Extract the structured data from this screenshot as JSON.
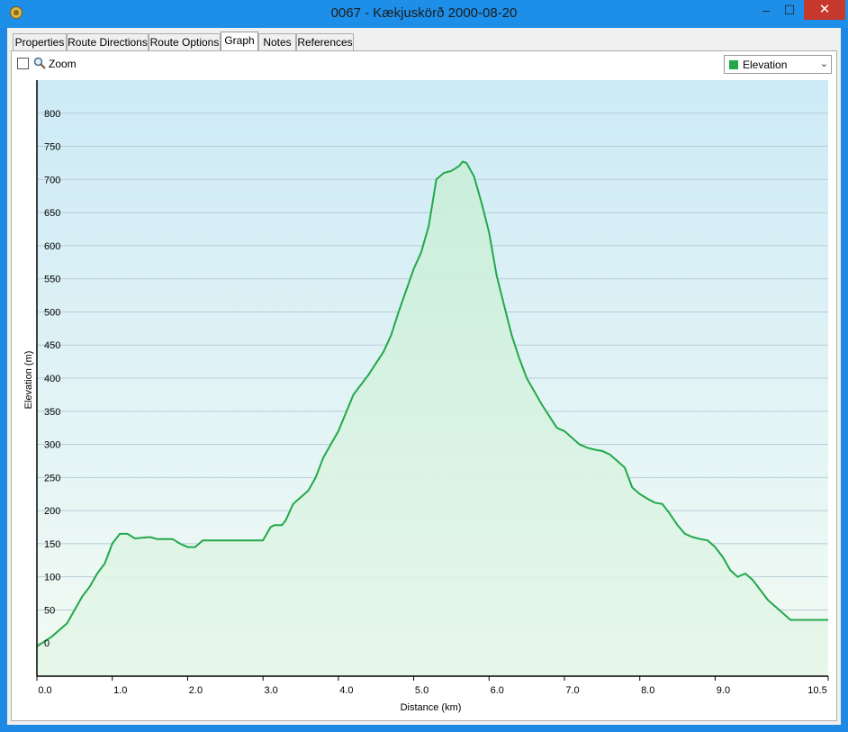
{
  "window": {
    "title": "0067 - Kækjuskörð 2000-08-20",
    "minimize_label": "–",
    "maximize_label": "☐",
    "close_label": "✕"
  },
  "tabs": [
    {
      "label": "Properties"
    },
    {
      "label": "Route Directions"
    },
    {
      "label": "Route Options"
    },
    {
      "label": "Graph"
    },
    {
      "label": "Notes"
    },
    {
      "label": "References"
    }
  ],
  "active_tab": "Graph",
  "toolbar": {
    "zoom_label": "Zoom",
    "zoom_checked": false,
    "series_selected": "Elevation",
    "series_color": "#22a84a"
  },
  "chart_data": {
    "type": "area",
    "xlabel": "Distance  (km)",
    "ylabel": "Elevation (m)",
    "xlim": [
      0,
      10.5
    ],
    "ylim": [
      -50,
      850
    ],
    "x_ticks": [
      0,
      1,
      2,
      3,
      4,
      5,
      6,
      7,
      8,
      9,
      10.5
    ],
    "x_tick_labels": [
      "0.0",
      "1.0",
      "2.0",
      "3.0",
      "4.0",
      "5.0",
      "6.0",
      "7.0",
      "8.0",
      "9.0",
      "10.5"
    ],
    "y_ticks": [
      0,
      50,
      100,
      150,
      200,
      250,
      300,
      350,
      400,
      450,
      500,
      550,
      600,
      650,
      700,
      750,
      800
    ],
    "grid": true,
    "line_color": "#22a84a",
    "series": [
      {
        "x": [
          0,
          0.2,
          0.4,
          0.6,
          0.7,
          0.8,
          0.9,
          1.0,
          1.1,
          1.2,
          1.3,
          1.5,
          1.6,
          1.8,
          1.9,
          2.0,
          2.1,
          2.2,
          2.5,
          2.8,
          3.0,
          3.1,
          3.15,
          3.25,
          3.3,
          3.4,
          3.5,
          3.6,
          3.7,
          3.8,
          4.0,
          4.2,
          4.4,
          4.6,
          4.7,
          4.8,
          5.0,
          5.1,
          5.2,
          5.3,
          5.4,
          5.5,
          5.6,
          5.65,
          5.7,
          5.8,
          5.9,
          6.0,
          6.1,
          6.2,
          6.3,
          6.4,
          6.5,
          6.7,
          6.9,
          7.0,
          7.1,
          7.2,
          7.3,
          7.4,
          7.5,
          7.6,
          7.7,
          7.8,
          7.9,
          8.0,
          8.1,
          8.2,
          8.3,
          8.4,
          8.5,
          8.6,
          8.7,
          8.8,
          8.9,
          9.0,
          9.1,
          9.2,
          9.3,
          9.4,
          9.5,
          9.6,
          9.7,
          9.8,
          9.9,
          10.0,
          10.1,
          10.2,
          10.5
        ],
        "y": [
          -5,
          10,
          30,
          70,
          85,
          105,
          120,
          150,
          165,
          165,
          158,
          160,
          157,
          157,
          150,
          145,
          145,
          155,
          155,
          155,
          155,
          175,
          178,
          178,
          185,
          210,
          220,
          230,
          250,
          280,
          320,
          375,
          405,
          440,
          465,
          500,
          565,
          590,
          630,
          700,
          710,
          713,
          720,
          727,
          725,
          705,
          665,
          620,
          555,
          510,
          465,
          430,
          400,
          360,
          325,
          320,
          310,
          300,
          295,
          292,
          290,
          285,
          275,
          265,
          235,
          225,
          218,
          212,
          210,
          195,
          178,
          165,
          160,
          157,
          155,
          145,
          130,
          110,
          100,
          105,
          95,
          80,
          65,
          55,
          45,
          35,
          35,
          35,
          35
        ]
      }
    ]
  }
}
